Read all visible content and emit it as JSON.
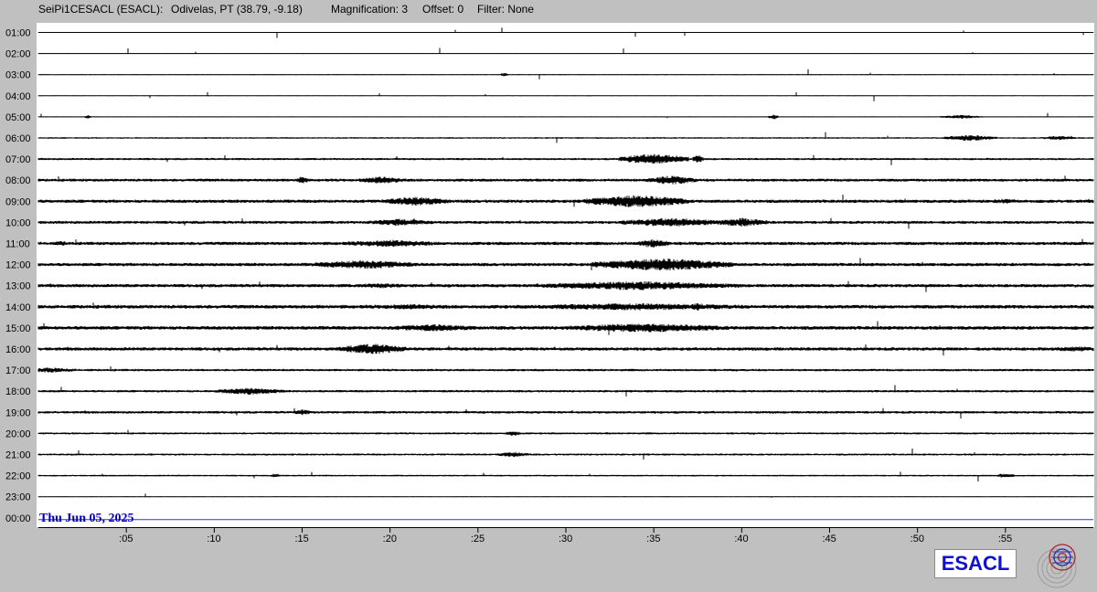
{
  "header": {
    "station": "SeiPi1CESACL (ESACL):",
    "location": "Odivelas, PT (38.79, -9.18)",
    "magnification": "Magnification: 3",
    "offset": "Offset: 0",
    "filter": "Filter: None"
  },
  "logo": {
    "text": "ESACL"
  },
  "colors": {
    "trace": "#000000",
    "date": "#0000cc",
    "current_line": "#3333cc",
    "background": "#c0c0c0",
    "plot": "#ffffff"
  },
  "chart_data": {
    "type": "line",
    "title": "",
    "xlabel": "",
    "ylabel": "",
    "date_label": "Thu Jun 05, 2025",
    "hour_labels": [
      "01:00",
      "02:00",
      "03:00",
      "04:00",
      "05:00",
      "06:00",
      "07:00",
      "08:00",
      "09:00",
      "10:00",
      "11:00",
      "12:00",
      "13:00",
      "14:00",
      "15:00",
      "16:00",
      "17:00",
      "18:00",
      "19:00",
      "20:00",
      "21:00",
      "22:00",
      "23:00",
      "00:00"
    ],
    "minute_ticks": [
      ":05",
      ":10",
      ":15",
      ":20",
      ":25",
      ":30",
      ":35",
      ":40",
      ":45",
      ":50",
      ":55"
    ],
    "xlim": [
      0,
      60
    ],
    "series": [
      {
        "hour": "01:00",
        "noise": 0.4,
        "bursts": []
      },
      {
        "hour": "02:00",
        "noise": 0.4,
        "bursts": []
      },
      {
        "hour": "03:00",
        "noise": 0.5,
        "bursts": [
          [
            26.5,
            2.5,
            0.2
          ]
        ]
      },
      {
        "hour": "04:00",
        "noise": 0.4,
        "bursts": []
      },
      {
        "hour": "05:00",
        "noise": 0.5,
        "bursts": [
          [
            2.8,
            2.2,
            0.2
          ],
          [
            41.8,
            3,
            0.3
          ],
          [
            52.5,
            2.2,
            1.2
          ]
        ]
      },
      {
        "hour": "06:00",
        "noise": 0.9,
        "bursts": [
          [
            53,
            3.5,
            1.5
          ],
          [
            58,
            2.5,
            1
          ]
        ]
      },
      {
        "hour": "07:00",
        "noise": 1.2,
        "bursts": [
          [
            35,
            6,
            2
          ],
          [
            37.5,
            5,
            0.3
          ]
        ]
      },
      {
        "hour": "08:00",
        "noise": 1.6,
        "bursts": [
          [
            15,
            5,
            0.3
          ],
          [
            19.5,
            4,
            1.5
          ],
          [
            36,
            5,
            1.5
          ]
        ]
      },
      {
        "hour": "09:00",
        "noise": 1.8,
        "bursts": [
          [
            21.5,
            5,
            2
          ],
          [
            34,
            7,
            3
          ],
          [
            55,
            3,
            1
          ]
        ]
      },
      {
        "hour": "10:00",
        "noise": 1.6,
        "bursts": [
          [
            20.5,
            4,
            2
          ],
          [
            36,
            5,
            3
          ],
          [
            40,
            5,
            1.5
          ]
        ]
      },
      {
        "hour": "11:00",
        "noise": 1.8,
        "bursts": [
          [
            1.3,
            3,
            0.5
          ],
          [
            20,
            4,
            3
          ],
          [
            35,
            5,
            1
          ]
        ]
      },
      {
        "hour": "12:00",
        "noise": 1.8,
        "bursts": [
          [
            18.5,
            5,
            3
          ],
          [
            35.5,
            7,
            4
          ]
        ]
      },
      {
        "hour": "13:00",
        "noise": 1.8,
        "bursts": [
          [
            19.5,
            3,
            2
          ],
          [
            34,
            5,
            6
          ]
        ]
      },
      {
        "hour": "14:00",
        "noise": 2.0,
        "bursts": [
          [
            21,
            3,
            4
          ],
          [
            34,
            4,
            8
          ],
          [
            37.5,
            4,
            1
          ]
        ]
      },
      {
        "hour": "15:00",
        "noise": 2.0,
        "bursts": [
          [
            22.5,
            4,
            3
          ],
          [
            34.5,
            5,
            5
          ]
        ]
      },
      {
        "hour": "16:00",
        "noise": 1.8,
        "bursts": [
          [
            19,
            6,
            2
          ],
          [
            59,
            3,
            2
          ]
        ]
      },
      {
        "hour": "17:00",
        "noise": 1.3,
        "bursts": [
          [
            0.5,
            3,
            2
          ]
        ]
      },
      {
        "hour": "18:00",
        "noise": 1.3,
        "bursts": [
          [
            12,
            4,
            2
          ]
        ]
      },
      {
        "hour": "19:00",
        "noise": 1.4,
        "bursts": [
          [
            15,
            3.5,
            0.5
          ]
        ]
      },
      {
        "hour": "20:00",
        "noise": 1.1,
        "bursts": [
          [
            27,
            3,
            0.5
          ]
        ]
      },
      {
        "hour": "21:00",
        "noise": 1.1,
        "bursts": [
          [
            27,
            3,
            1
          ]
        ]
      },
      {
        "hour": "22:00",
        "noise": 0.9,
        "bursts": [
          [
            13.5,
            2.5,
            0.3
          ],
          [
            55,
            3,
            0.5
          ]
        ]
      },
      {
        "hour": "23:00",
        "noise": 0.4,
        "bursts": []
      },
      {
        "hour": "00:00",
        "noise": 0,
        "bursts": []
      }
    ]
  }
}
